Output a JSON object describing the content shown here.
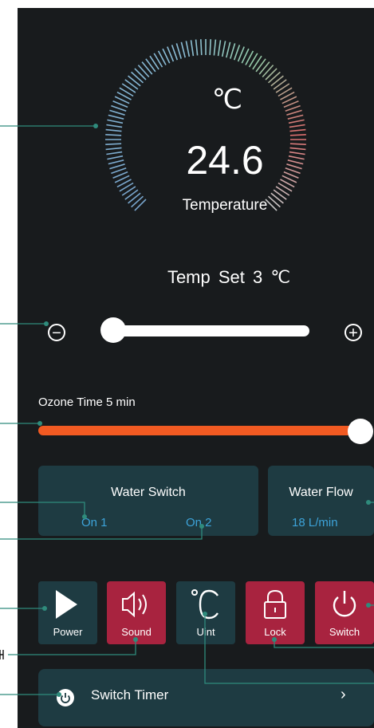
{
  "gauge": {
    "unit": "℃",
    "value": "24.6",
    "label": "Temperature"
  },
  "temp_set": "Temp Set  3  ℃",
  "temp_slider": {
    "minus_glyph": "−",
    "plus_glyph": "+",
    "level": 0
  },
  "ozone": {
    "label": "Ozone Time 5 min",
    "level": 1.0
  },
  "water_switch": {
    "title": "Water Switch",
    "on1": "On 1",
    "on2": "On 2"
  },
  "water_flow": {
    "title": "Water Flow",
    "value": "18 L/min"
  },
  "tiles": [
    {
      "label": "Power",
      "icon": "play-icon"
    },
    {
      "label": "Sound",
      "icon": "speaker-icon"
    },
    {
      "label": "Uint",
      "icon": "celsius-icon"
    },
    {
      "label": "Lock",
      "icon": "lock-icon"
    },
    {
      "label": "Switch",
      "icon": "power-icon"
    }
  ],
  "timer": {
    "label": "Switch Timer",
    "chevron": "›"
  },
  "colors": {
    "background": "#181b1d",
    "card": "#1e3b42",
    "accent_red": "#a8233f",
    "slider_orange": "#f15a22",
    "value_blue": "#3da3d9",
    "annotation": "#2f8b7c"
  }
}
